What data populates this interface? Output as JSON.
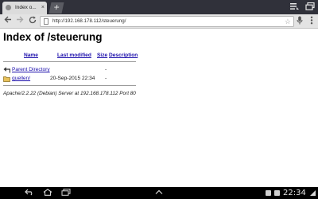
{
  "browser": {
    "tab": {
      "title": "Index o...",
      "close_glyph": "×"
    },
    "new_tab_glyph": "+",
    "url": "http://192.168.178.112/steuerung/"
  },
  "page": {
    "title": "Index of /steuerung",
    "columns": {
      "name": "Name",
      "last_modified": "Last modified",
      "size": "Size",
      "description": "Description"
    },
    "entries": [
      {
        "name": "Parent Directory",
        "date": "",
        "size": "-",
        "icon": "back-arrow-icon"
      },
      {
        "name": "quellen/",
        "date": "20-Sep-2015 22:34",
        "size": "-",
        "icon": "folder-icon"
      }
    ],
    "address": "Apache/2.2.22 (Debian) Server at 192.168.178.112 Port 80"
  },
  "system_bar": {
    "clock": "22:34"
  },
  "colors": {
    "link": "#1a0dab",
    "tab_strip": "#30313a",
    "toolbar": "#e3e3e3",
    "folder": "#e8c15a"
  }
}
